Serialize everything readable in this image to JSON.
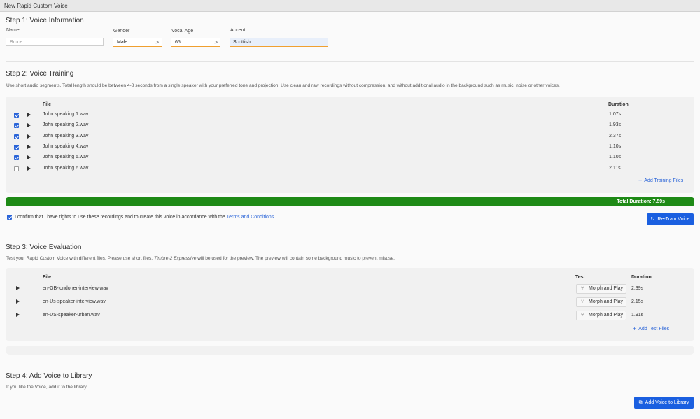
{
  "window": {
    "title": "New Rapid Custom Voice"
  },
  "step1": {
    "title": "Step 1: Voice Information",
    "name_label": "Name",
    "name_placeholder": "Bruce",
    "gender_label": "Gender",
    "gender_value": "Male",
    "age_label": "Vocal Age",
    "age_value": "65",
    "accent_label": "Accent",
    "accent_value": "Scottish"
  },
  "step2": {
    "title": "Step 2: Voice Training",
    "hint": "Use short audio segments. Total length should be between 4-8 seconds from a single speaker with your preferred tone and projection. Use clean and raw recordings without compression, and without additional audio in the background such as music, noise or other voices.",
    "col_file": "File",
    "col_duration": "Duration",
    "files": [
      {
        "name": "John speaking 1.wav",
        "duration": "1.07s",
        "checked": true
      },
      {
        "name": "John speaking 2.wav",
        "duration": "1.93s",
        "checked": true
      },
      {
        "name": "John speaking 3.wav",
        "duration": "2.37s",
        "checked": true
      },
      {
        "name": "John speaking 4.wav",
        "duration": "1.10s",
        "checked": true
      },
      {
        "name": "John speaking 5.wav",
        "duration": "1.10s",
        "checked": true
      },
      {
        "name": "John speaking 6.wav",
        "duration": "2.11s",
        "checked": false
      }
    ],
    "add_files": "Add Training Files",
    "total_duration": "Total Duration: 7.59s",
    "consent_text": "I confirm that I have rights to use these recordings and to create this voice in accordance with the",
    "consent_link": "Terms and Conditions",
    "consent_checked": true,
    "retrain_button": "Re-Train Voice",
    "accent_color": "#1e8a16"
  },
  "step3": {
    "title": "Step 3: Voice Evaluation",
    "hint_pre": "Test your Rapid Custom Voice with different files. Please use short files.",
    "hint_model": "Timbre-2 Expressive",
    "hint_post": "will be used for the preview. The preview will contain some background music to prevent misuse.",
    "col_file": "File",
    "col_test": "Test",
    "col_duration": "Duration",
    "files": [
      {
        "name": "en-GB-londoner-interview.wav",
        "test_label": "Morph and Play",
        "duration": "2.39s"
      },
      {
        "name": "en-Us-speaker-interview.wav",
        "test_label": "Morph and Play",
        "duration": "2.15s"
      },
      {
        "name": "en-US-speaker-urban.wav",
        "test_label": "Morph and Play",
        "duration": "1.91s"
      }
    ],
    "add_files": "Add Test Files"
  },
  "step4": {
    "title": "Step 4: Add Voice to Library",
    "hint": "If you like the Voice, add it to the library.",
    "add_button": "Add Voice to Library"
  },
  "colors": {
    "primary": "#1a5fe0",
    "progress": "#1e8a16",
    "field_underline": "#f0a030"
  }
}
